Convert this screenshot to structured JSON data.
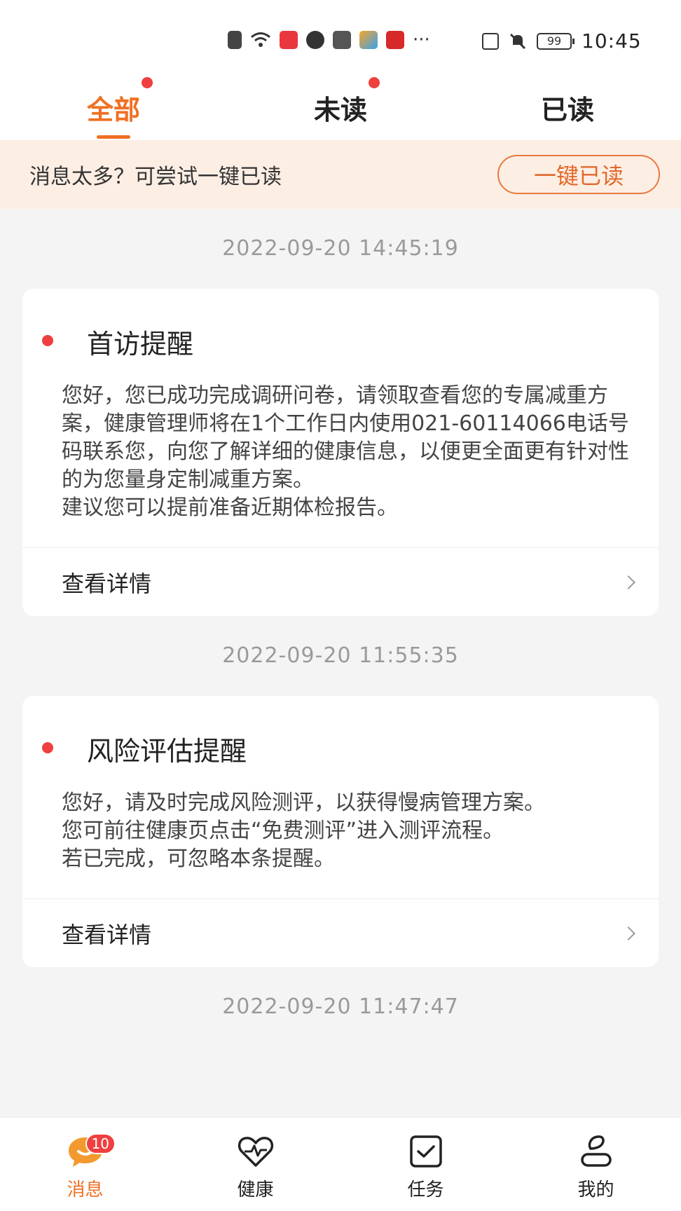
{
  "status_bar": {
    "time": "10:45",
    "battery": "99",
    "overflow": "···",
    "icons": [
      "sim-icon",
      "wifi-icon",
      "app-icon",
      "wechat-icon",
      "alipay-icon",
      "app-icon",
      "app-icon",
      "nfc-icon",
      "mute-icon",
      "battery-icon"
    ]
  },
  "tabs": [
    {
      "label": "全部",
      "active": true,
      "dot": true
    },
    {
      "label": "未读",
      "active": false,
      "dot": true
    },
    {
      "label": "已读",
      "active": false,
      "dot": false
    }
  ],
  "notice": {
    "text": "消息太多？可尝试一键已读",
    "button": "一键已读"
  },
  "messages": [
    {
      "timestamp": "2022-09-20 14:45:19",
      "title": "首访提醒",
      "unread": true,
      "body": "您好，您已成功完成调研问卷，请领取查看您的专属减重方案，健康管理师将在1个工作日内使用021-60114066电话号码联系您，向您了解详细的健康信息，以便更全面更有针对性的为您量身定制减重方案。\n建议您可以提前准备近期体检报告。",
      "action": "查看详情"
    },
    {
      "timestamp": "2022-09-20 11:55:35",
      "title": "风险评估提醒",
      "unread": true,
      "body": "您好，请及时完成风险测评，以获得慢病管理方案。\n您可前往健康页点击“免费测评”进入测评流程。\n若已完成，可忽略本条提醒。",
      "action": "查看详情"
    },
    {
      "timestamp": "2022-09-20 11:47:47"
    }
  ],
  "bottom_nav": [
    {
      "label": "消息",
      "icon": "message-icon",
      "active": true,
      "badge": "10"
    },
    {
      "label": "健康",
      "icon": "heart-pulse-icon",
      "active": false
    },
    {
      "label": "任务",
      "icon": "task-check-icon",
      "active": false
    },
    {
      "label": "我的",
      "icon": "profile-icon",
      "active": false
    }
  ],
  "colors": {
    "accent": "#f07023",
    "dot": "#ef3f3f",
    "notice_bg": "#fdeee4"
  }
}
